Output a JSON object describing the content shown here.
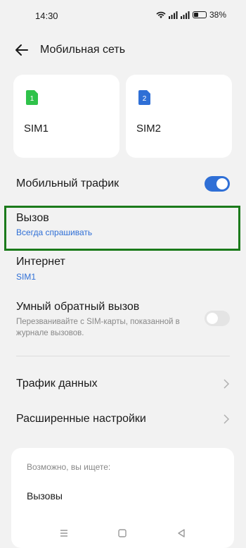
{
  "status": {
    "time": "14:30",
    "battery": "38%",
    "battery_level": 0.38
  },
  "header": {
    "title": "Мобильная сеть"
  },
  "sims": [
    {
      "number": "1",
      "label": "SIM1",
      "color": "#2fc24a"
    },
    {
      "number": "2",
      "label": "SIM2",
      "color": "#2f6fd6"
    }
  ],
  "settings": {
    "mobile_traffic": {
      "label": "Мобильный трафик",
      "enabled": true
    },
    "call": {
      "label": "Вызов",
      "value": "Всегда спрашивать"
    },
    "internet": {
      "label": "Интернет",
      "value": "SIM1"
    },
    "smart_callback": {
      "label": "Умный обратный вызов",
      "description": "Перезванивайте с SIM-карты, показанной в журнале вызовов.",
      "enabled": false
    },
    "data_traffic": {
      "label": "Трафик данных"
    },
    "advanced": {
      "label": "Расширенные настройки"
    }
  },
  "suggestions": {
    "heading": "Возможно, вы ищете:",
    "items": [
      "Вызовы"
    ]
  },
  "colors": {
    "accent": "#2f6fd6",
    "highlight": "#1b7a1b",
    "background": "#f2f2f2"
  }
}
